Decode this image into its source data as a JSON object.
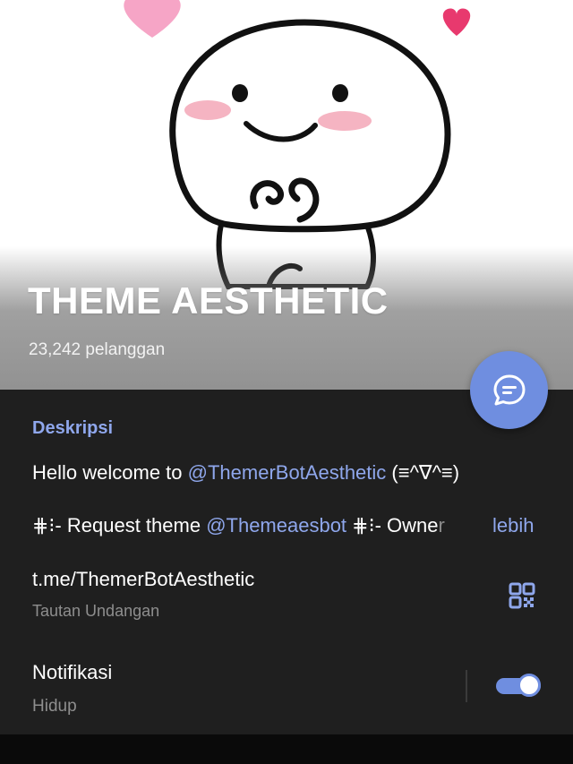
{
  "header": {
    "title": "THEME AESTHETIC",
    "subscribers": "23,242 pelanggan"
  },
  "fab": {
    "icon": "message-icon"
  },
  "description": {
    "label": "Deskripsi",
    "line1_prefix": "Hello welcome to ",
    "line1_mention": "@ThemerBotAesthetic",
    "line1_suffix": " (≡^∇^≡)",
    "line2_prefix": "⋕⁝- Request theme ",
    "line2_mention": "@Themeaesbot",
    "line2_suffix": " ⋕⁝- Owne",
    "line2_fade": "r",
    "more": "lebih"
  },
  "invite": {
    "link": "t.me/ThemerBotAesthetic",
    "label": "Tautan Undangan",
    "icon": "qr-code-icon"
  },
  "notifications": {
    "label": "Notifikasi",
    "status": "Hidup",
    "enabled": true
  },
  "colors": {
    "accent": "#6f8ee0",
    "link": "#8fa7ec",
    "background": "#1f1f1f",
    "secondary_text": "#8e8e8e"
  }
}
